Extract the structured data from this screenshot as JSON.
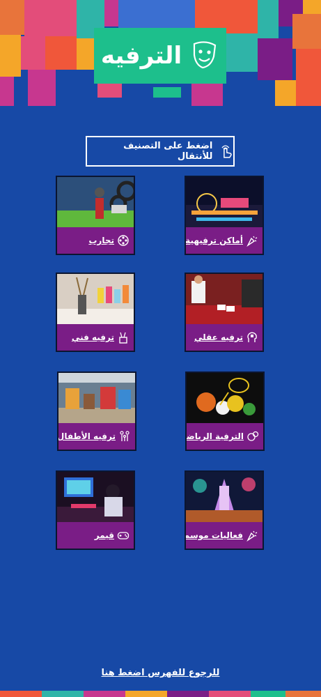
{
  "header": {
    "title": "الترفيه",
    "icon": "theater-masks-icon"
  },
  "hint": {
    "text": "اضغط على التصنيف للأنتقال",
    "icon": "tap-hand-icon"
  },
  "cards": [
    {
      "label": "أماكن ترفيهية",
      "icon": "party-popper-icon"
    },
    {
      "label": "تجارب",
      "icon": "film-reel-icon"
    },
    {
      "label": "ترفيه عقلي",
      "icon": "puzzle-head-icon"
    },
    {
      "label": "ترفيه فني",
      "icon": "paint-brushes-icon"
    },
    {
      "label": "الترفية الرياضي",
      "icon": "sports-balls-icon"
    },
    {
      "label": "ترفيه الأطفال",
      "icon": "family-icon"
    },
    {
      "label": "فعاليات موسمية",
      "icon": "party-popper-icon"
    },
    {
      "label": "قيمر",
      "icon": "gamepad-icon"
    }
  ],
  "footer": {
    "back_link": "للرجوع للفهرس اضغط هنا"
  },
  "colors": {
    "background": "#1749a6",
    "title_box": "#1dbf8c",
    "card_bar": "#7a1d86"
  }
}
